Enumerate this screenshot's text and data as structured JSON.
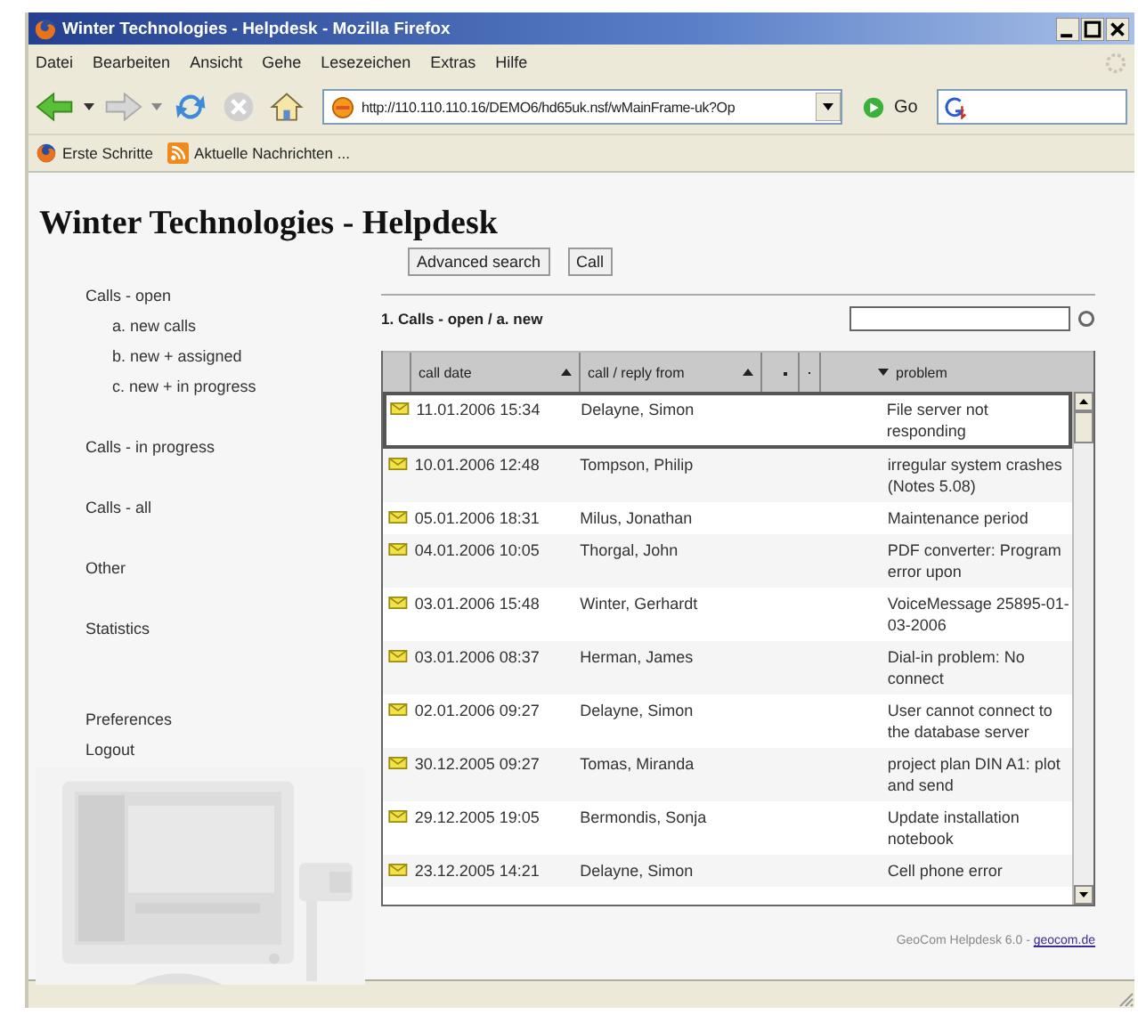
{
  "window": {
    "title": "Winter Technologies - Helpdesk - Mozilla Firefox"
  },
  "menu": [
    "Datei",
    "Bearbeiten",
    "Ansicht",
    "Gehe",
    "Lesezeichen",
    "Extras",
    "Hilfe"
  ],
  "toolbar": {
    "url": "http://110.110.110.16/DEMO6/hd65uk.nsf/wMainFrame-uk?Op",
    "go_label": "Go"
  },
  "bookmarks": [
    "Erste Schritte",
    "Aktuelle Nachrichten ..."
  ],
  "page": {
    "heading": "Winter Technologies - Helpdesk",
    "sidebar": {
      "items": [
        {
          "label": "Calls - open",
          "children": [
            {
              "label": "a. new calls"
            },
            {
              "label": "b. new + assigned"
            },
            {
              "label": "c. new + in progress"
            }
          ]
        },
        {
          "label": "Calls - in progress"
        },
        {
          "label": "Calls - all"
        },
        {
          "label": "Other"
        },
        {
          "label": "Statistics"
        }
      ],
      "footer_items": [
        "Preferences",
        "Logout"
      ]
    },
    "buttons": [
      "Advanced search",
      "Call"
    ],
    "section_title": "1. Calls - open / a. new",
    "table": {
      "columns": [
        {
          "label": "call date",
          "sorted": true,
          "descending": false
        },
        {
          "label": "call / reply from",
          "sorted": true,
          "descending": false
        },
        {
          "sorted": false
        },
        {
          "sorted": false
        },
        {
          "label": "problem",
          "sorted": true,
          "descending": true
        }
      ],
      "rows": [
        {
          "date": "11.01.2006 15:34",
          "from": "Delayne, Simon",
          "problem": "File server not responding",
          "selected": true
        },
        {
          "date": "10.01.2006 12:48",
          "from": "Tompson, Philip",
          "problem": "irregular system crashes (Notes 5.08)",
          "selected": false
        },
        {
          "date": "05.01.2006 18:31",
          "from": "Milus, Jonathan",
          "problem": "Maintenance period",
          "selected": false
        },
        {
          "date": "04.01.2006 10:05",
          "from": "Thorgal, John",
          "problem": "PDF converter: Program error upon",
          "selected": false
        },
        {
          "date": "03.01.2006 15:48",
          "from": "Winter, Gerhardt",
          "problem": "VoiceMessage 25895-01-03-2006",
          "selected": false
        },
        {
          "date": "03.01.2006 08:37",
          "from": "Herman, James",
          "problem": "Dial-in problem: No connect",
          "selected": false
        },
        {
          "date": "02.01.2006 09:27",
          "from": "Delayne, Simon",
          "problem": "User cannot connect to the database server",
          "selected": false
        },
        {
          "date": "30.12.2005 09:27",
          "from": "Tomas, Miranda",
          "problem": "project plan DIN A1: plot and send",
          "selected": false
        },
        {
          "date": "29.12.2005 19:05",
          "from": "Bermondis, Sonja",
          "problem": "Update installation notebook",
          "selected": false
        },
        {
          "date": "23.12.2005 14:21",
          "from": "Delayne, Simon",
          "problem": "Cell phone error",
          "selected": false
        }
      ]
    },
    "footer": {
      "text": "GeoCom Helpdesk 6.0 - ",
      "link": "geocom.de"
    }
  }
}
